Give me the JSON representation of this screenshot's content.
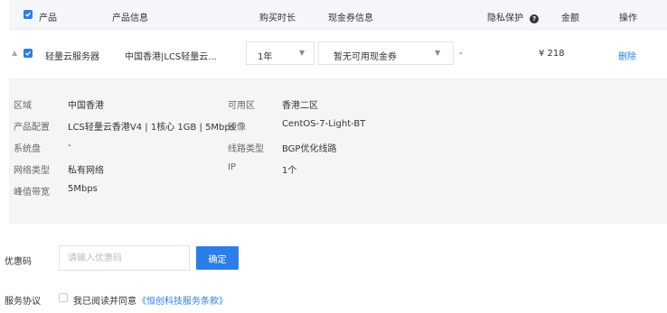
{
  "table": {
    "headers": {
      "product": "产品",
      "product_info": "产品信息",
      "duration": "购买时长",
      "coupon_info": "现金券信息",
      "privacy": "隐私保护",
      "amount": "金额",
      "action": "操作"
    },
    "privacy_help_icon": "question-icon",
    "row": {
      "product": "轻量云服务器",
      "product_info": "中国香港|LCS轻量云...",
      "duration": "1年",
      "coupon": "暂无可用现金券",
      "privacy": "-",
      "amount": "¥ 218",
      "action": "删除"
    }
  },
  "details": {
    "region_label": "区域",
    "region_value": "中国香港",
    "config_label": "产品配置",
    "config_value": "LCS轻量云香港V4 | 1核心 1GB | 5Mbps",
    "disk_label": "系统盘",
    "disk_value": "-",
    "network_label": "网络类型",
    "network_value": "私有网络",
    "bandwidth_label": "峰值带宽",
    "bandwidth_value": "5Mbps",
    "zone_label": "可用区",
    "zone_value": "香港二区",
    "image_label": "镜像",
    "image_value": "CentOS-7-Light-BT",
    "line_label": "线路类型",
    "line_value": "BGP优化线路",
    "ip_label": "IP",
    "ip_value": "1个"
  },
  "coupon": {
    "label": "优惠码",
    "placeholder": "请输入优惠码",
    "confirm": "确定"
  },
  "agreement": {
    "label": "服务协议",
    "text": "我已阅读并同意",
    "link": "《恒创科技服务条款》"
  },
  "colors": {
    "accent": "#2b7ee8",
    "header_bg": "#f4f6f9",
    "detail_bg": "#f4f5f7"
  }
}
